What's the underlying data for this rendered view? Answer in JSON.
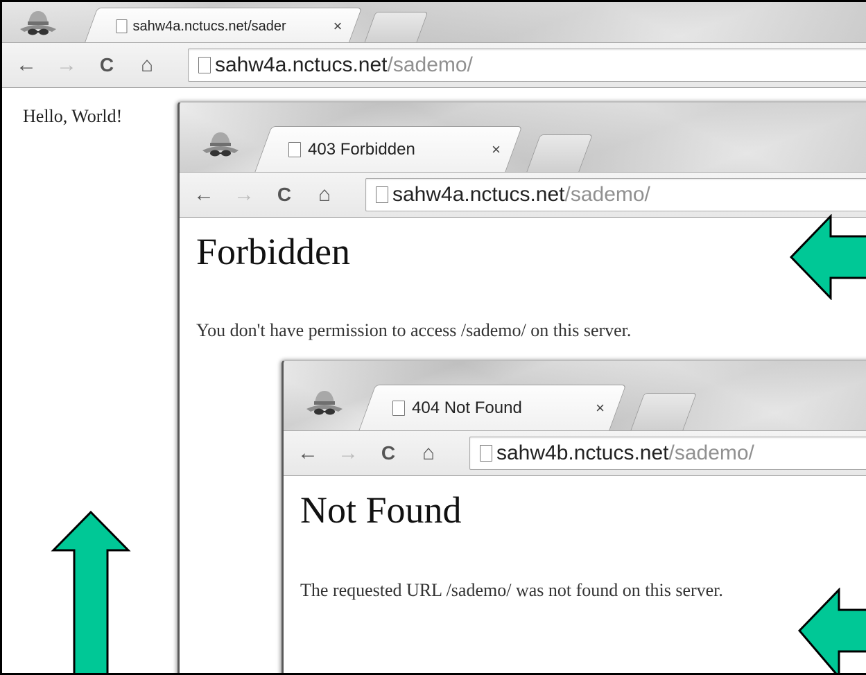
{
  "outer_window": {
    "tab": {
      "title": "sahw4a.nctucs.net/sader"
    },
    "address": {
      "host": "sahw4a.nctucs.net",
      "path": "/sademo/"
    },
    "content": {
      "text": "Hello, World!"
    }
  },
  "middle_window": {
    "tab": {
      "title": "403 Forbidden"
    },
    "address": {
      "host": "sahw4a.nctucs.net",
      "path": "/sademo/"
    },
    "content": {
      "heading": "Forbidden",
      "message": "You don't have permission to access /sademo/ on this server."
    }
  },
  "inner_window": {
    "tab": {
      "title": "404 Not Found"
    },
    "address": {
      "host": "sahw4b.nctucs.net",
      "path": "/sademo/"
    },
    "content": {
      "heading": "Not Found",
      "message": "The requested URL /sademo/ was not found on this server."
    }
  },
  "glyphs": {
    "back": "←",
    "forward": "→",
    "reload": "C",
    "home": "⌂",
    "close": "×"
  },
  "colors": {
    "arrow_fill": "#00c896",
    "arrow_stroke": "#000000"
  }
}
